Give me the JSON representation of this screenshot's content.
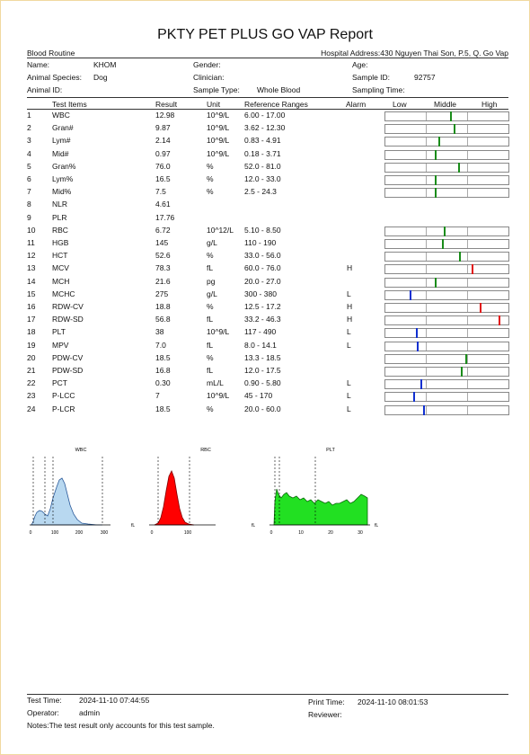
{
  "report": {
    "title": "PKTY PET PLUS GO VAP Report",
    "section": "Blood Routine",
    "hospital_address": "Hospital Address:430 Nguyen Thai Son, P.5, Q. Go Vap"
  },
  "patient": {
    "name_label": "Name:",
    "name": "KHOM",
    "gender_label": "Gender:",
    "gender": "",
    "age_label": "Age:",
    "age": "",
    "species_label": "Animal Species:",
    "species": "Dog",
    "clinician_label": "Clinician:",
    "clinician": "",
    "sample_id_label": "Sample ID:",
    "sample_id": "92757",
    "animal_id_label": "Animal ID:",
    "animal_id": "",
    "sample_type_label": "Sample Type:",
    "sample_type": "Whole Blood",
    "sampling_time_label": "Sampling Time:",
    "sampling_time": ""
  },
  "table": {
    "headers": {
      "items": "Test Items",
      "result": "Result",
      "unit": "Unit",
      "ranges": "Reference Ranges",
      "alarm": "Alarm",
      "low": "Low",
      "middle": "Middle",
      "high": "High"
    },
    "rows": [
      {
        "no": "1",
        "item": "WBC",
        "result": "12.98",
        "unit": "10^9/L",
        "range": "6.00 - 17.00",
        "alarm": "",
        "marker": 0.53,
        "mcolor": "#1a8c1a"
      },
      {
        "no": "2",
        "item": "Gran#",
        "result": "9.87",
        "unit": "10^9/L",
        "range": "3.62 - 12.30",
        "alarm": "",
        "marker": 0.56,
        "mcolor": "#1a8c1a"
      },
      {
        "no": "3",
        "item": "Lym#",
        "result": "2.14",
        "unit": "10^9/L",
        "range": "0.83 - 4.91",
        "alarm": "",
        "marker": 0.44,
        "mcolor": "#1a8c1a"
      },
      {
        "no": "4",
        "item": "Mid#",
        "result": "0.97",
        "unit": "10^9/L",
        "range": "0.18 - 3.71",
        "alarm": "",
        "marker": 0.41,
        "mcolor": "#1a8c1a"
      },
      {
        "no": "5",
        "item": "Gran%",
        "result": "76.0",
        "unit": "%",
        "range": "52.0 - 81.0",
        "alarm": "",
        "marker": 0.6,
        "mcolor": "#1a8c1a"
      },
      {
        "no": "6",
        "item": "Lym%",
        "result": "16.5",
        "unit": "%",
        "range": "12.0 - 33.0",
        "alarm": "",
        "marker": 0.41,
        "mcolor": "#1a8c1a"
      },
      {
        "no": "7",
        "item": "Mid%",
        "result": "7.5",
        "unit": "%",
        "range": "2.5 - 24.3",
        "alarm": "",
        "marker": 0.41,
        "mcolor": "#1a8c1a"
      },
      {
        "no": "8",
        "item": "NLR",
        "result": "4.61",
        "unit": "",
        "range": "",
        "alarm": "",
        "marker": null,
        "mcolor": ""
      },
      {
        "no": "9",
        "item": "PLR",
        "result": "17.76",
        "unit": "",
        "range": "",
        "alarm": "",
        "marker": null,
        "mcolor": ""
      },
      {
        "no": "10",
        "item": "RBC",
        "result": "6.72",
        "unit": "10^12/L",
        "range": "5.10 - 8.50",
        "alarm": "",
        "marker": 0.48,
        "mcolor": "#1a8c1a"
      },
      {
        "no": "11",
        "item": "HGB",
        "result": "145",
        "unit": "g/L",
        "range": "110 - 190",
        "alarm": "",
        "marker": 0.47,
        "mcolor": "#1a8c1a"
      },
      {
        "no": "12",
        "item": "HCT",
        "result": "52.6",
        "unit": "%",
        "range": "33.0 - 56.0",
        "alarm": "",
        "marker": 0.61,
        "mcolor": "#1a8c1a"
      },
      {
        "no": "13",
        "item": "MCV",
        "result": "78.3",
        "unit": "fL",
        "range": "60.0 - 76.0",
        "alarm": "H",
        "marker": 0.71,
        "mcolor": "#e01010"
      },
      {
        "no": "14",
        "item": "MCH",
        "result": "21.6",
        "unit": "pg",
        "range": "20.0 - 27.0",
        "alarm": "",
        "marker": 0.41,
        "mcolor": "#1a8c1a"
      },
      {
        "no": "15",
        "item": "MCHC",
        "result": "275",
        "unit": "g/L",
        "range": "300 - 380",
        "alarm": "L",
        "marker": 0.2,
        "mcolor": "#1030d0"
      },
      {
        "no": "16",
        "item": "RDW-CV",
        "result": "18.8",
        "unit": "%",
        "range": "12.5 - 17.2",
        "alarm": "H",
        "marker": 0.78,
        "mcolor": "#e01010"
      },
      {
        "no": "17",
        "item": "RDW-SD",
        "result": "56.8",
        "unit": "fL",
        "range": "33.2 - 46.3",
        "alarm": "H",
        "marker": 0.93,
        "mcolor": "#e01010"
      },
      {
        "no": "18",
        "item": "PLT",
        "result": "38",
        "unit": "10^9/L",
        "range": "117 - 490",
        "alarm": "L",
        "marker": 0.25,
        "mcolor": "#1030d0"
      },
      {
        "no": "19",
        "item": "MPV",
        "result": "7.0",
        "unit": "fL",
        "range": "8.0 - 14.1",
        "alarm": "L",
        "marker": 0.26,
        "mcolor": "#1030d0"
      },
      {
        "no": "20",
        "item": "PDW-CV",
        "result": "18.5",
        "unit": "%",
        "range": "13.3 - 18.5",
        "alarm": "",
        "marker": 0.66,
        "mcolor": "#1a8c1a"
      },
      {
        "no": "21",
        "item": "PDW-SD",
        "result": "16.8",
        "unit": "fL",
        "range": "12.0 - 17.5",
        "alarm": "",
        "marker": 0.62,
        "mcolor": "#1a8c1a"
      },
      {
        "no": "22",
        "item": "PCT",
        "result": "0.30",
        "unit": "mL/L",
        "range": "0.90 - 5.80",
        "alarm": "L",
        "marker": 0.29,
        "mcolor": "#1030d0"
      },
      {
        "no": "23",
        "item": "P-LCC",
        "result": "7",
        "unit": "10^9/L",
        "range": "45 - 170",
        "alarm": "L",
        "marker": 0.23,
        "mcolor": "#1030d0"
      },
      {
        "no": "24",
        "item": "P-LCR",
        "result": "18.5",
        "unit": "%",
        "range": "20.0 - 60.0",
        "alarm": "L",
        "marker": 0.31,
        "mcolor": "#1030d0"
      }
    ]
  },
  "histograms": [
    {
      "title": "WBC",
      "xticks": [
        "0",
        "100",
        "200",
        "300"
      ],
      "unit": "fL"
    },
    {
      "title": "RBC",
      "xticks": [
        "0",
        "100"
      ],
      "unit": "fL"
    },
    {
      "title": "PLT",
      "xticks": [
        "0",
        "10",
        "20",
        "30"
      ],
      "unit_left": "fL",
      "unit": "fL"
    }
  ],
  "footer": {
    "test_time_label": "Test Time:",
    "test_time": "2024-11-10 07:44:55",
    "print_time_label": "Print Time:",
    "print_time": "2024-11-10 08:01:53",
    "operator_label": "Operator:",
    "operator": "admin",
    "reviewer_label": "Reviewer:",
    "reviewer": "",
    "notes": "Notes:The test result only accounts for this test sample."
  },
  "colors": {
    "wbc_fill": "#b8d8f0",
    "rbc_fill": "#ff0000",
    "plt_fill": "#22e022",
    "normal": "#1a8c1a",
    "high": "#e01010",
    "low": "#1030d0"
  }
}
